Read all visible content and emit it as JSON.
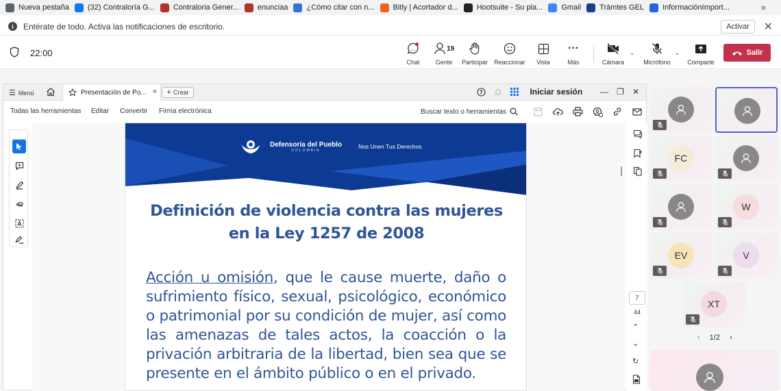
{
  "bookmarks": [
    {
      "label": "Nueva pestaña",
      "icon": "globe-icon",
      "color": "#5f6368"
    },
    {
      "label": "(32) Contraloría G...",
      "icon": "facebook-icon",
      "color": "#1877f2"
    },
    {
      "label": "Contraloria Gener...",
      "icon": "contraloria-icon",
      "color": "#b0352a"
    },
    {
      "label": "enunciaa",
      "icon": "contraloria-icon",
      "color": "#b0352a"
    },
    {
      "label": "¿Cómo citar con n...",
      "icon": "doc-icon",
      "color": "#3b6fd8"
    },
    {
      "label": "Bitly | Acortador d...",
      "icon": "bitly-icon",
      "color": "#ee6123"
    },
    {
      "label": "Hootsuite - Su pla...",
      "icon": "hootsuite-icon",
      "color": "#222222"
    },
    {
      "label": "Gmail",
      "icon": "google-icon",
      "color": "#4285f4"
    },
    {
      "label": "Trámtes GEL",
      "icon": "gel-icon",
      "color": "#1a3e8a"
    },
    {
      "label": "InformaciónImport...",
      "icon": "info-icon",
      "color": "#2a62d9"
    }
  ],
  "bookmarks_more": "»",
  "notification": {
    "message": "Entérate de todo. Activa las notificaciones de escritorio.",
    "button": "Activar"
  },
  "meeting": {
    "timer": "22:00",
    "participants_count": "19",
    "tools": {
      "chat": "Chat",
      "people": "Gente",
      "raise": "Participar",
      "react": "Reaccionar",
      "view": "Vista",
      "more": "Más",
      "camera": "Cámara",
      "mic": "Micrófono",
      "share": "Comparte"
    },
    "leave": "Salir",
    "accent": "#c4314b"
  },
  "acrobat": {
    "menu": "Menú",
    "tab_title": "Presentación de Po...",
    "create": "Crear",
    "sign_in": "Iniciar sesión",
    "tools": [
      "Todas las herramientas",
      "Editar",
      "Convertir",
      "Firma electrónica"
    ],
    "search_tools": "Buscar texto o herramientas",
    "page_current": "7",
    "page_total": "44"
  },
  "slide": {
    "brand_name": "Defensoría del Pueblo",
    "brand_sub": "COLOMBIA",
    "brand_slogan": "Nos Unen Tus Derechos",
    "title_line1": "Definición de violencia contra las mujeres",
    "title_line2": "en la Ley 1257 de 2008",
    "body_underlined": "Acción u omisión",
    "body_rest": ", que le cause muerte, daño o sufrimiento físico, sexual, psicológico, económico o patrimonial por su condición de mujer, así como las amenazas de tales actos, la coacción o la privación arbitraria de la libertad, bien sea que se presente en el ámbito público o en el privado.",
    "text_color": "#2f5597"
  },
  "participants": [
    {
      "initials": "",
      "type": "photo-placeholder",
      "muted": true
    },
    {
      "initials": "",
      "type": "photo-placeholder",
      "muted": false,
      "selected": true
    },
    {
      "initials": "FC",
      "type": "initials",
      "bg": "#f3ecd9",
      "muted": true
    },
    {
      "initials": "",
      "type": "photo-placeholder",
      "muted": true
    },
    {
      "initials": "",
      "type": "photo-placeholder",
      "muted": true
    },
    {
      "initials": "W",
      "type": "initials",
      "bg": "#f6dcdc",
      "muted": true
    },
    {
      "initials": "EV",
      "type": "initials",
      "bg": "#f5e5b8",
      "muted": true
    },
    {
      "initials": "V",
      "type": "initials",
      "bg": "#eddcef",
      "muted": true
    },
    {
      "initials": "XT",
      "type": "initials",
      "bg": "#f3d9e2",
      "muted": true
    }
  ],
  "pager": {
    "label": "1/2",
    "prev": "‹",
    "next": "›"
  }
}
